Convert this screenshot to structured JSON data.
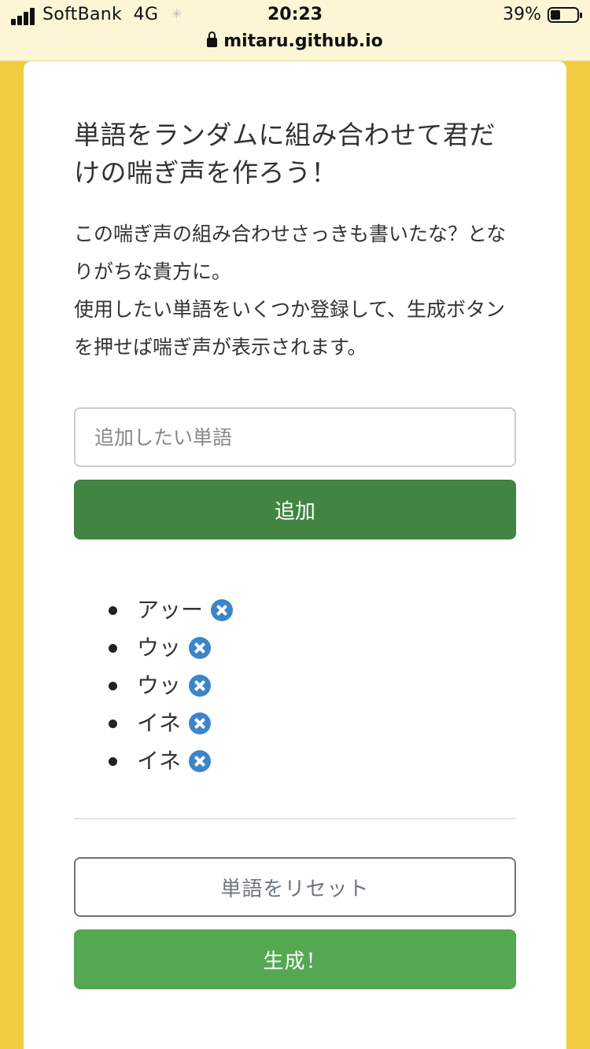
{
  "status_bar": {
    "carrier": "SoftBank",
    "network": "4G",
    "time": "20:23",
    "battery_percent": "39%",
    "battery_level": 0.39,
    "url": "mitaru.github.io"
  },
  "page": {
    "title": "単語をランダムに組み合わせて君だけの喘ぎ声を作ろう！",
    "description_lines": [
      "この喘ぎ声の組み合わせさっきも書いたな？となりがちな貴方に。",
      "使用したい単語をいくつか登録して、生成ボタンを押せば喘ぎ声が表示されます。"
    ],
    "input_placeholder": "追加したい単語",
    "add_button": "追加",
    "words": [
      "アッー",
      "ウッ",
      "ウッ",
      "イネ",
      "イネ"
    ],
    "reset_button": "単語をリセット",
    "generate_button": "生成！"
  },
  "colors": {
    "background": "#f2cd41",
    "add_button": "#428542",
    "generate_button": "#54a852",
    "remove_icon": "#3b85c9",
    "reset_border": "#6c757d"
  }
}
